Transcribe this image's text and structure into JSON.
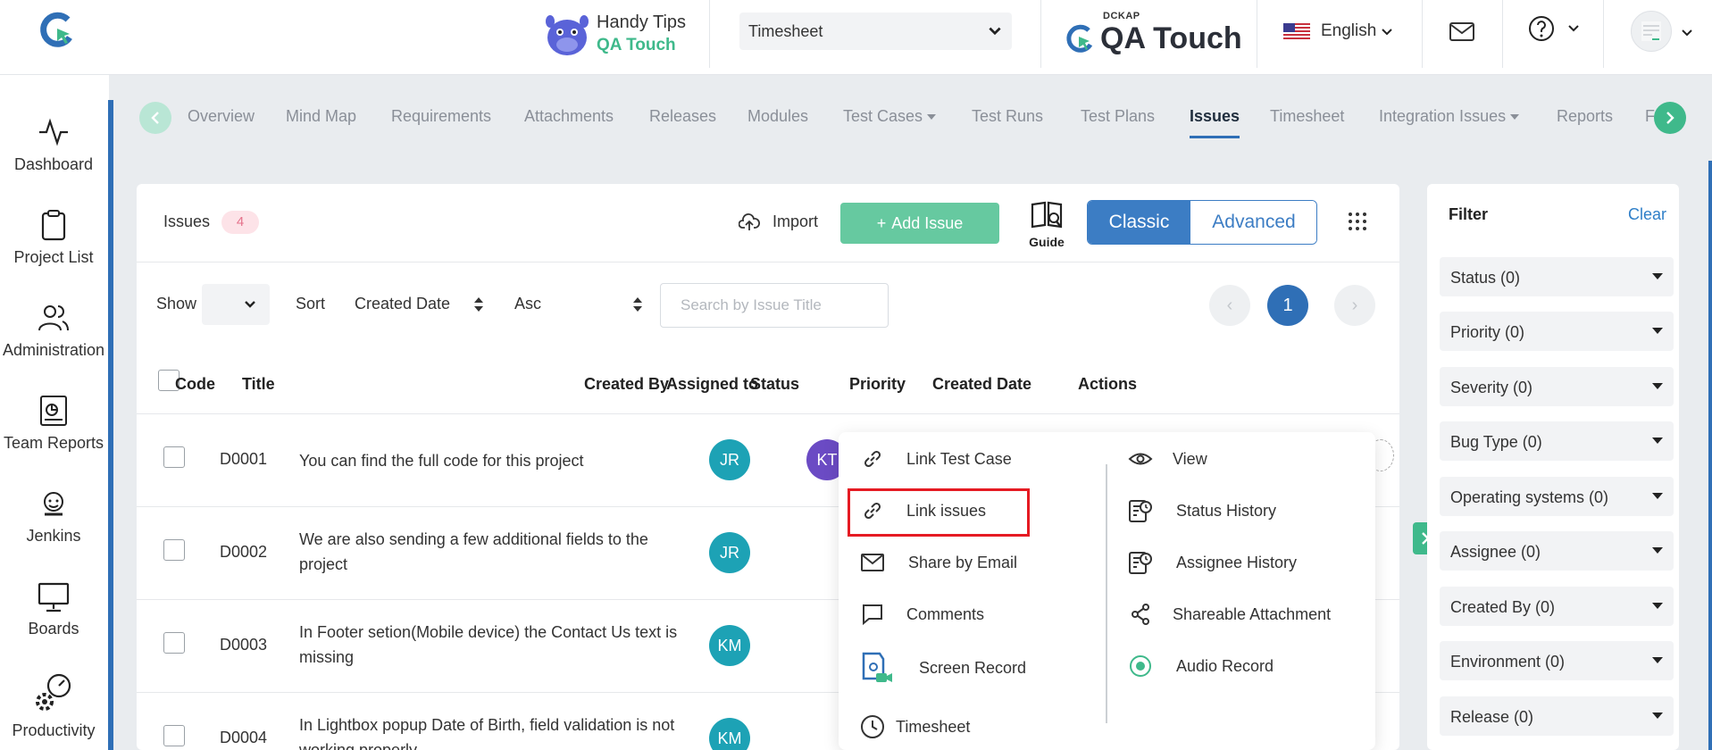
{
  "header": {
    "handy_tips_line1": "Handy Tips",
    "handy_tips_line2": "QA Touch",
    "project_select": "Timesheet",
    "brand_small": "DCKAP",
    "brand_name": "QA Touch",
    "language": "English"
  },
  "sidebar": {
    "items": [
      {
        "label": "Dashboard",
        "icon": "activity-icon"
      },
      {
        "label": "Project List",
        "icon": "clipboard-icon"
      },
      {
        "label": "Administration",
        "icon": "users-icon"
      },
      {
        "label": "Team Reports",
        "icon": "report-icon"
      },
      {
        "label": "Jenkins",
        "icon": "jenkins-icon"
      },
      {
        "label": "Boards",
        "icon": "board-icon"
      },
      {
        "label": "Productivity",
        "icon": "productivity-icon"
      }
    ]
  },
  "tabs": [
    {
      "label": "Overview"
    },
    {
      "label": "Mind Map"
    },
    {
      "label": "Requirements"
    },
    {
      "label": "Attachments"
    },
    {
      "label": "Releases"
    },
    {
      "label": "Modules"
    },
    {
      "label": "Test Cases"
    },
    {
      "label": "Test Runs"
    },
    {
      "label": "Test Plans"
    },
    {
      "label": "Issues"
    },
    {
      "label": "Timesheet"
    },
    {
      "label": "Integration Issues"
    },
    {
      "label": "Reports"
    },
    {
      "label": "F"
    }
  ],
  "issues": {
    "title": "Issues",
    "count": "4",
    "import_label": "Import",
    "add_label": "Add Issue",
    "guide_label": "Guide",
    "view_classic": "Classic",
    "view_advanced": "Advanced"
  },
  "toolbar": {
    "show_label": "Show",
    "sort_label": "Sort",
    "sort_field": "Created Date",
    "sort_order": "Asc",
    "search_placeholder": "Search by Issue Title",
    "page_prev": "‹",
    "current_page": "1",
    "page_next": "›"
  },
  "table": {
    "columns": [
      "Code",
      "Title",
      "Created By",
      "Assigned to",
      "Status",
      "Priority",
      "Created Date",
      "Actions"
    ],
    "rows": [
      {
        "code": "D0001",
        "title": "You can find the full code for this project",
        "created_by": "JR",
        "assigned_to": "KT"
      },
      {
        "code": "D0002",
        "title": "We are also sending a few additional fields to the project",
        "created_by": "JR",
        "assigned_to": ""
      },
      {
        "code": "D0003",
        "title": "In Footer setion(Mobile device) the Contact Us text is missing",
        "created_by": "KM",
        "assigned_to": ""
      },
      {
        "code": "D0004",
        "title": "In Lightbox popup Date of Birth, field validation is not working properly",
        "created_by": "KM",
        "assigned_to": ""
      }
    ]
  },
  "menu": {
    "left": [
      {
        "label": "Link Test Case",
        "icon": "link-icon"
      },
      {
        "label": "Link issues",
        "icon": "link-icon"
      },
      {
        "label": "Share by Email",
        "icon": "email-icon"
      },
      {
        "label": "Comments",
        "icon": "comment-icon"
      },
      {
        "label": "Screen Record",
        "icon": "screen-record-icon"
      },
      {
        "label": "Timesheet",
        "icon": "clock-icon"
      }
    ],
    "right": [
      {
        "label": "View",
        "icon": "eye-icon"
      },
      {
        "label": "Status History",
        "icon": "history-icon"
      },
      {
        "label": "Assignee History",
        "icon": "history-icon"
      },
      {
        "label": "Shareable Attachment",
        "icon": "share-icon"
      },
      {
        "label": "Audio Record",
        "icon": "record-icon"
      }
    ]
  },
  "filter": {
    "title": "Filter",
    "clear": "Clear",
    "items": [
      "Status (0)",
      "Priority (0)",
      "Severity (0)",
      "Bug Type (0)",
      "Operating systems (0)",
      "Assignee (0)",
      "Created By (0)",
      "Environment (0)",
      "Release (0)"
    ]
  },
  "colors": {
    "primary": "#2f6fb6",
    "accent_green": "#3fb98b",
    "add_button": "#66c9a0",
    "highlight_box": "#e51b23",
    "badge_bg": "#fde3e8"
  }
}
